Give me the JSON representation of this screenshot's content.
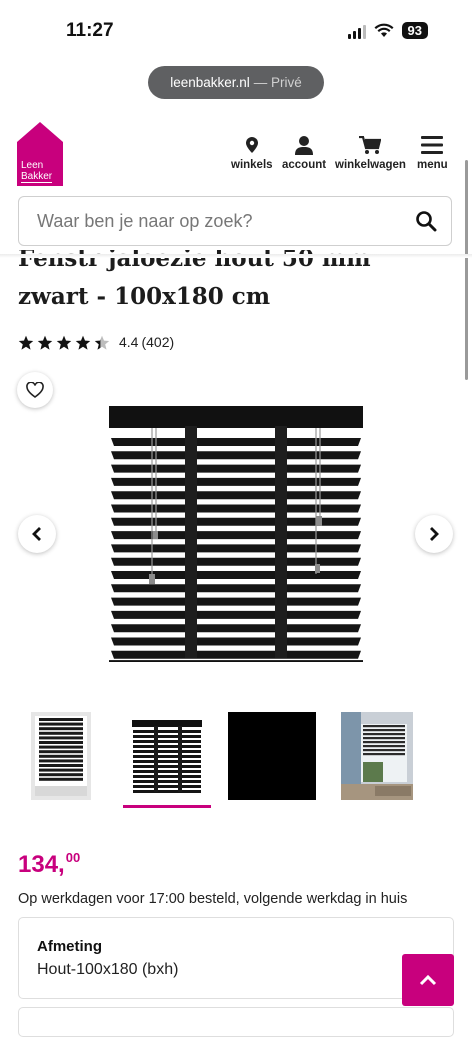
{
  "status_bar": {
    "time": "11:27",
    "battery": "93"
  },
  "browser": {
    "domain": "leenbakker.nl",
    "mode": "— Privé"
  },
  "brand": {
    "line1": "Leen",
    "line2": "Bakker",
    "color": "#c8007d"
  },
  "nav": [
    {
      "label": "winkels",
      "icon": "location-pin-icon"
    },
    {
      "label": "account",
      "icon": "user-icon"
    },
    {
      "label": "winkelwagen",
      "icon": "cart-icon"
    },
    {
      "label": "menu",
      "icon": "hamburger-menu-icon"
    }
  ],
  "search": {
    "placeholder": "Waar ben je naar op zoek?"
  },
  "product": {
    "title_line1": "Fenstr jaloezie hout 50 mm",
    "title_line2": "zwart - 100x180 cm",
    "rating": "4.4",
    "rating_count": "(402)",
    "stars": 4.4,
    "price_main": "134,",
    "price_cents": "00",
    "delivery": "Op werkdagen voor 17:00 besteld, volgende werkdag in huis",
    "option_label": "Afmeting",
    "option_value": "Hout-100x180 (bxh)"
  },
  "thumbnails": [
    "window-with-blind",
    "blind-front",
    "black-color-swatch",
    "room-photo"
  ],
  "active_thumbnail": 1
}
